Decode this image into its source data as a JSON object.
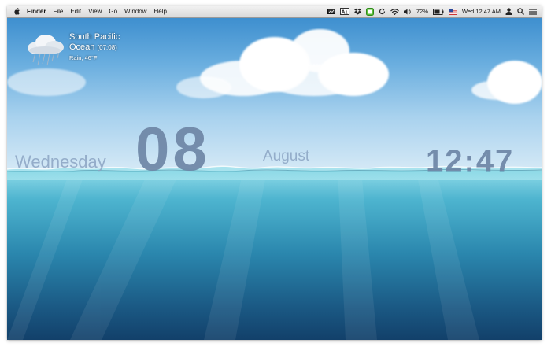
{
  "menubar": {
    "app_name": "Finder",
    "menus": [
      "File",
      "Edit",
      "View",
      "Go",
      "Window",
      "Help"
    ],
    "battery": "72%",
    "clock": "Wed 12:47 AM",
    "status_icons": [
      "display-icon",
      "adobe-icon",
      "dropbox-icon",
      "evernote-icon",
      "sync-icon",
      "wifi-icon",
      "volume-icon",
      "battery-icon",
      "flag-icon",
      "user-icon",
      "spotlight-icon",
      "notification-list-icon"
    ]
  },
  "weather": {
    "location_line1": "South Pacific",
    "location_line2": "Ocean",
    "local_time": "(07:08)",
    "condition": "Rain, 46°F",
    "icon": "rain-cloud-icon"
  },
  "datetime": {
    "weekday": "Wednesday",
    "day": "08",
    "month": "August",
    "time": "12:47"
  },
  "colors": {
    "sky_top": "#3e8fcf",
    "water_surface": "#8fd9e8",
    "water_deep": "#12406a",
    "text_large": "#6e86a6",
    "text_light": "#8ba4c3"
  }
}
